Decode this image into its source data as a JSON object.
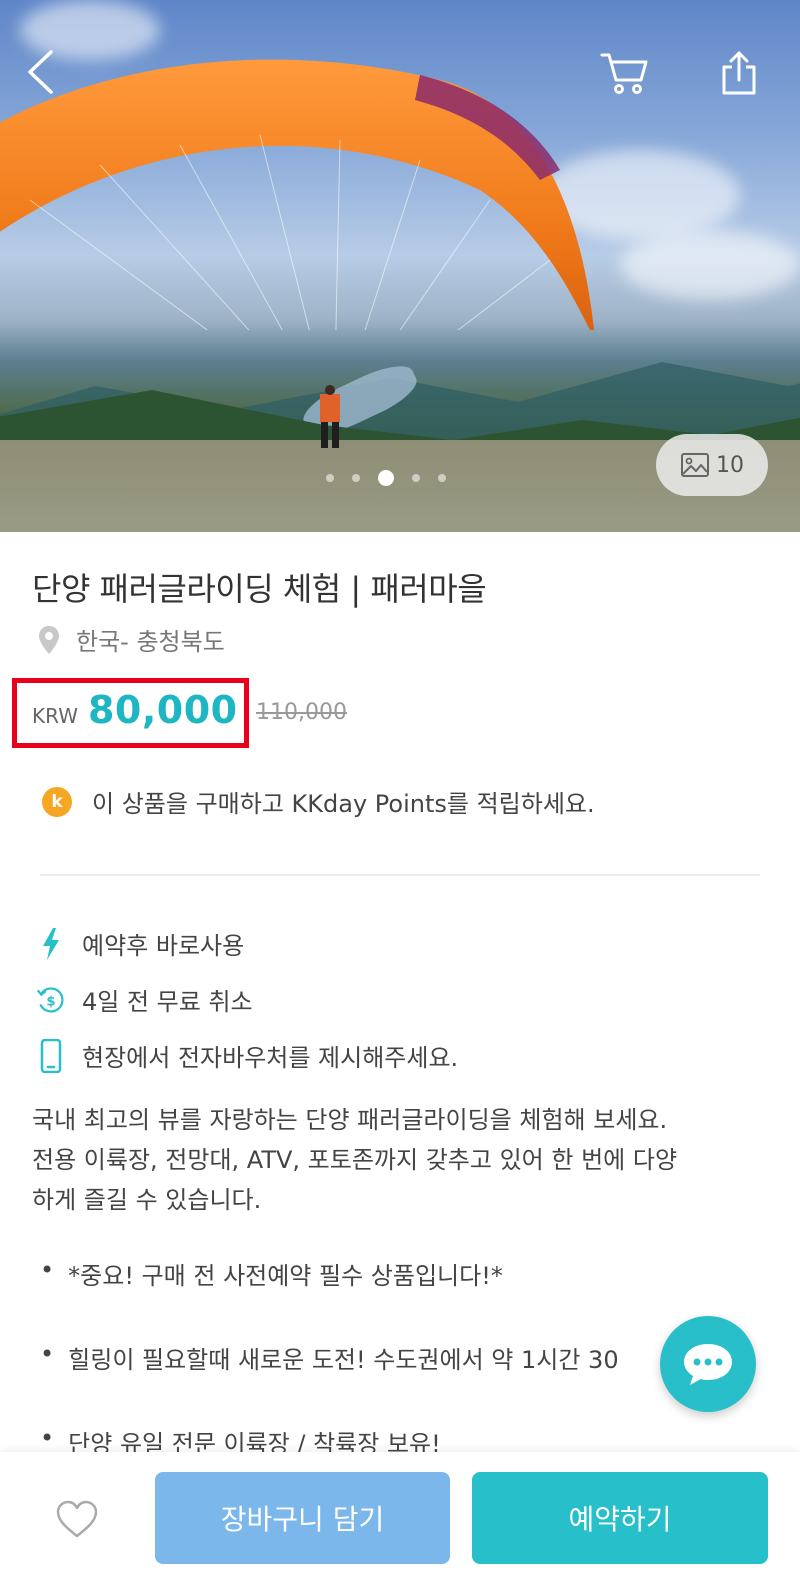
{
  "hero": {
    "photo_count": "10",
    "carousel_total": 5,
    "carousel_active_index": 2
  },
  "product": {
    "title": "단양 패러글라이딩 체험 | 패러마을",
    "location": "한국- 충청북도",
    "currency": "KRW",
    "price": "80,000",
    "original_price": "110,000",
    "points_text": "이 상품을 구매하고 KKday Points를 적립하세요.",
    "points_badge": "k"
  },
  "features": [
    {
      "icon": "lightning-icon",
      "text": "예약후 바로사용"
    },
    {
      "icon": "refund-dollar-icon",
      "text": "4일 전 무료 취소"
    },
    {
      "icon": "phone-icon",
      "text": "현장에서 전자바우처를 제시해주세요."
    }
  ],
  "description": {
    "line1": "국내 최고의 뷰를 자랑하는 단양 패러글라이딩을 체험해 보세요.",
    "line2": "전용 이륙장, 전망대, ATV, 포토존까지 갖추고 있어 한 번에 다양",
    "line3": "하게 즐길 수 있습니다."
  },
  "bullets": [
    "*중요! 구매 전 사전예약 필수 상품입니다!*",
    "힐링이 필요할때 새로운 도전! 수도권에서 약 1시간 30",
    "단양 유일 전문 이륙장 / 착륙장 보유!"
  ],
  "bottom_bar": {
    "add_to_cart_label": "장바구니 담기",
    "book_label": "예약하기"
  },
  "colors": {
    "accent": "#27bfca",
    "price": "#1fb6c4",
    "cart_button": "#7cb7ec",
    "highlight_box": "#e8001d",
    "coin": "#f5a623"
  }
}
